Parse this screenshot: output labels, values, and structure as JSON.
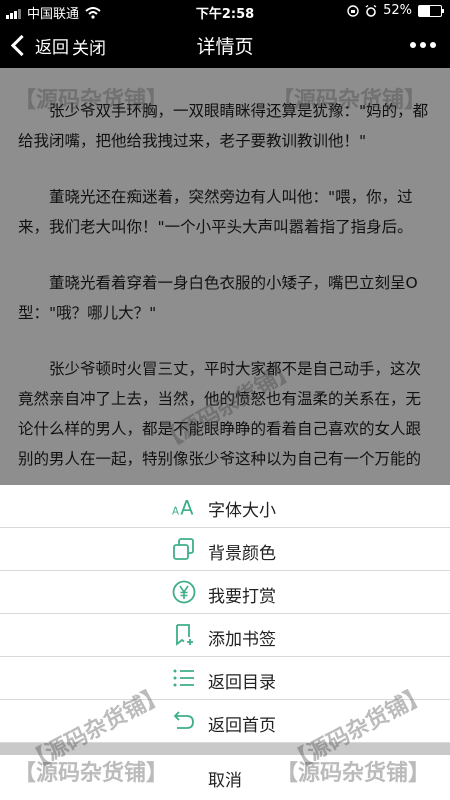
{
  "status": {
    "carrier": "中国联通",
    "time": "下午2:58",
    "battery": "52%",
    "battery_level": 0.52
  },
  "nav": {
    "back_label": "返回",
    "close_label": "关闭",
    "title": "详情页"
  },
  "article": {
    "paragraphs": [
      "张少爷双手环胸，一双眼睛眯得还算是犹豫：\"妈的，都给我闭嘴，把他给我拽过来，老子要教训教训他！\"",
      "董晓光还在痴迷着，突然旁边有人叫他：\"喂，你，过来，我们老大叫你！\"一个小平头大声叫嚣着指了指身后。",
      "董晓光看着穿着一身白色衣服的小矮子，嘴巴立刻呈O型：\"哦？哪儿大？\"",
      "张少爷顿时火冒三丈，平时大家都不是自己动手，这次竟然亲自冲了上去，当然，他的愤怒也有温柔的关系在，无论什么样的男人，都是不能眼睁睁的看着自己喜欢的女人跟别的男人在一起，特别像张少爷这种以为自己有一个万能的"
    ]
  },
  "watermark": "【源码杂货铺】",
  "menu": {
    "accent": "#3fae8a",
    "items": [
      {
        "label": "字体大小",
        "icon": "font-size-icon"
      },
      {
        "label": "背景颜色",
        "icon": "background-color-icon"
      },
      {
        "label": "我要打赏",
        "icon": "reward-yen-icon"
      },
      {
        "label": "添加书签",
        "icon": "add-bookmark-icon"
      },
      {
        "label": "返回目录",
        "icon": "catalog-list-icon"
      },
      {
        "label": "返回首页",
        "icon": "return-home-icon"
      }
    ],
    "cancel_label": "取消"
  }
}
